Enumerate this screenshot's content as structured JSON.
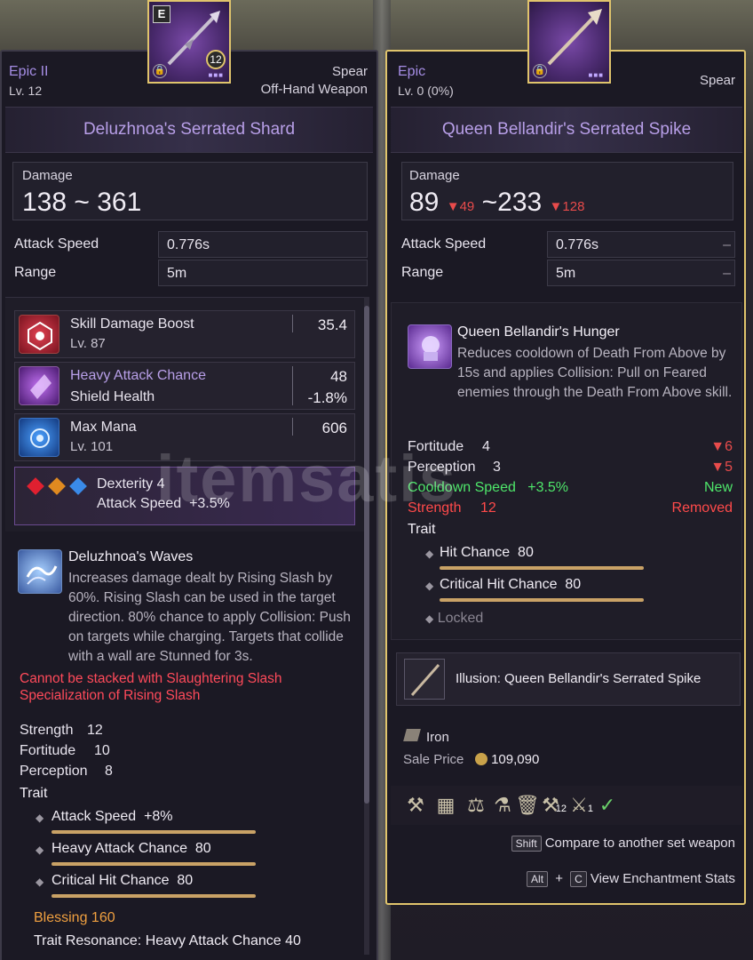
{
  "left": {
    "rarity": "Epic II",
    "level": "Lv. 12",
    "type": "Spear",
    "slot": "Off-Hand Weapon",
    "icon_badge": "E",
    "icon_level": "12",
    "name": "Deluzhnoa's Serrated Shard",
    "damage_label": "Damage",
    "damage_value": "138 ~ 361",
    "attack_speed_label": "Attack Speed",
    "attack_speed_value": "0.776s",
    "range_label": "Range",
    "range_value": "5m",
    "traits_cards": [
      {
        "name": "Skill Damage Boost",
        "value": "35.4",
        "sub": "Lv. 87",
        "sub_value": ""
      },
      {
        "name": "Heavy Attack Chance",
        "value": "48",
        "sub": "Shield Health",
        "sub_value": "-1.8%"
      },
      {
        "name": "Max Mana",
        "value": "606",
        "sub": "Lv. 101",
        "sub_value": ""
      }
    ],
    "gem_line1": "Dexterity 4",
    "gem_line2": "Attack Speed",
    "gem_line2_value": "+3.5%",
    "skill_name": "Deluzhnoa's Waves",
    "skill_desc": "Increases damage dealt by Rising Slash by 60%. Rising Slash can be used in the target direction. 80% chance to apply Collision: Push on targets while charging. Targets that collide with a wall are Stunned for 3s.",
    "warning": "Cannot be stacked with Slaughtering Slash Specialization of Rising Slash",
    "stats": [
      {
        "label": "Strength",
        "value": "12"
      },
      {
        "label": "Fortitude",
        "value": "10"
      },
      {
        "label": "Perception",
        "value": "8"
      }
    ],
    "trait_header": "Trait",
    "traits": [
      {
        "label": "Attack Speed",
        "value": "+8%"
      },
      {
        "label": "Heavy Attack Chance",
        "value": "80"
      },
      {
        "label": "Critical Hit Chance",
        "value": "80"
      }
    ],
    "blessing": "Blessing 160",
    "resonance": "Trait Resonance: Heavy Attack Chance 40"
  },
  "right": {
    "rarity": "Epic",
    "level": "Lv. 0 (0%)",
    "type": "Spear",
    "name": "Queen Bellandir's Serrated Spike",
    "damage_label": "Damage",
    "damage_min": "89",
    "damage_min_diff": "49",
    "damage_sep": "~",
    "damage_max": "233",
    "damage_max_diff": "128",
    "attack_speed_label": "Attack Speed",
    "attack_speed_value": "0.776s",
    "attack_speed_diff": "–",
    "range_label": "Range",
    "range_value": "5m",
    "range_diff": "–",
    "skill_name": "Queen Bellandir's Hunger",
    "skill_desc": "Reduces cooldown of Death From Above by 15s and applies Collision: Pull on Feared enemies through the Death From Above skill.",
    "stats": [
      {
        "label": "Fortitude",
        "value": "4",
        "diff": "6"
      },
      {
        "label": "Perception",
        "value": "3",
        "diff": "5"
      }
    ],
    "cooldown_label": "Cooldown Speed",
    "cooldown_value": "+3.5%",
    "cooldown_status": "New",
    "strength_label": "Strength",
    "strength_value": "12",
    "strength_status": "Removed",
    "trait_header": "Trait",
    "traits": [
      {
        "label": "Hit Chance",
        "value": "80"
      },
      {
        "label": "Critical Hit Chance",
        "value": "80"
      }
    ],
    "locked": "Locked",
    "illusion": "Illusion: Queen Bellandir's Serrated Spike",
    "material": "Iron",
    "sale_label": "Sale Price",
    "sale_value": "109,090",
    "tool_counts": {
      "c1": "12",
      "c2": "1"
    },
    "shift_key": "Shift",
    "compare_text": "Compare to another set weapon",
    "alt_key": "Alt",
    "plus": "+",
    "c_key": "C",
    "enchant_text": "View Enchantment Stats"
  },
  "watermark": "itemsatis",
  "colors": {
    "gold_border": "#e0c46c",
    "epic_purple": "#a58de4",
    "name_purple": "#b89fe8",
    "down_red": "#e84b4b",
    "new_green": "#4ee66a",
    "removed_red": "#ff4a4a",
    "blessing_orange": "#f0a040"
  }
}
